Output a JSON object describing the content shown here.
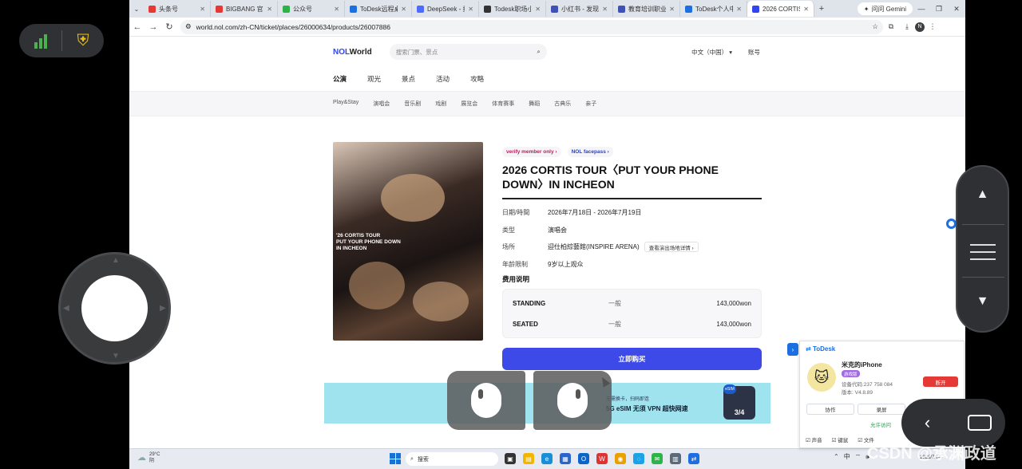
{
  "browser": {
    "tabs": [
      {
        "label": "头条号",
        "color": "#e53935"
      },
      {
        "label": "BIGBANG 官网",
        "color": "#e53935"
      },
      {
        "label": "公众号",
        "color": "#2fb14a"
      },
      {
        "label": "ToDesk远程桌",
        "color": "#1b6fe0"
      },
      {
        "label": "DeepSeek - 探",
        "color": "#4d6bfe"
      },
      {
        "label": "Todesk职场小",
        "color": "#333333"
      },
      {
        "label": "小红书 - 发现",
        "color": "#3f51b5"
      },
      {
        "label": "教育培训职业",
        "color": "#3f51b5"
      },
      {
        "label": "ToDesk个人中",
        "color": "#1b6fe0"
      },
      {
        "label": "2026 CORTIS",
        "color": "#3344ee",
        "active": true
      }
    ],
    "gemini_label": "问问 Gemini",
    "url": "world.nol.com/zh-CN/ticket/places/26000634/products/26007886",
    "profile_initial": "N"
  },
  "site": {
    "logo_nol": "NOL",
    "logo_world": "World",
    "search_placeholder": "搜索门票、景点",
    "language": "中文（中国） ▾",
    "account": "账号",
    "main_nav": [
      "公演",
      "观光",
      "景点",
      "活动",
      "攻略"
    ],
    "sub_nav": [
      "Play&Stay",
      "演唱会",
      "音乐剧",
      "戏剧",
      "展览会",
      "体育赛事",
      "舞蹈",
      "古典乐",
      "亲子"
    ]
  },
  "product": {
    "badges": [
      "verify member only ›",
      "NOL facepass ›"
    ],
    "title": "2026 CORTIS TOUR〈PUT YOUR PHONE DOWN〉IN INCHEON",
    "poster_text": "'26 CORTIS TOUR\nPUT YOUR PHONE DOWN\nIN INCHEON",
    "info": [
      {
        "key": "日期/時間",
        "value": "2026年7月18日 - 2026年7月19日"
      },
      {
        "key": "类型",
        "value": "演唱会"
      },
      {
        "key": "场所",
        "value": "迎仕柏綜藝館(INSPIRE ARENA)",
        "chip": "查看演出场地详情 ›"
      },
      {
        "key": "年龄限制",
        "value": "9岁以上观众"
      }
    ],
    "fee_title": "费用说明",
    "fees": [
      {
        "tier": "STANDING",
        "kind": "一般",
        "price": "143,000won"
      },
      {
        "tier": "SEATED",
        "kind": "一般",
        "price": "143,000won"
      }
    ],
    "buy_label": "立即购买"
  },
  "ad": {
    "sub": "无需换卡，扫码即连",
    "main": "5G eSIM 无须 VPN 超快网速",
    "pill": "eSIM",
    "card": "3/4"
  },
  "taskbar": {
    "weather_temp": "29°C",
    "weather_desc": "阴",
    "search": "搜索",
    "ime": "中",
    "date": "2026/7/14"
  },
  "todesk": {
    "title": "ToDesk",
    "device_name": "米克的iPhone",
    "tag": "游戏版",
    "code": "设备代码:237 758 084",
    "version": "版本: V4.8.89",
    "disconnect": "断开",
    "collab": "协作",
    "record": "录屏",
    "stop": "停止",
    "allow_access": "允许访问",
    "bottom": [
      "声音",
      "键鼠",
      "文件"
    ]
  },
  "watermark": "CSDN @承渊政道"
}
